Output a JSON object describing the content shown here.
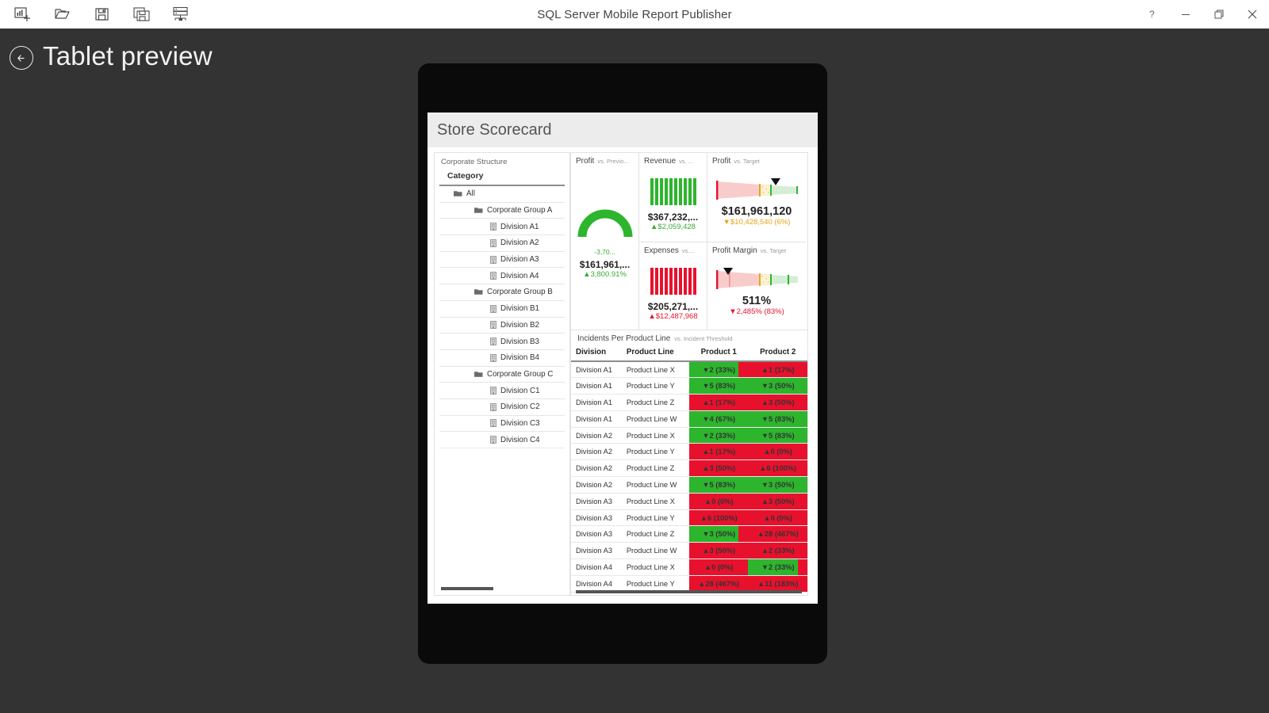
{
  "window": {
    "title": "SQL Server Mobile Report Publisher",
    "toolbar": [
      {
        "name": "new-report-icon",
        "label": "New report"
      },
      {
        "name": "open-folder-icon",
        "label": "Open"
      },
      {
        "name": "save-icon",
        "label": "Save"
      },
      {
        "name": "save-as-icon",
        "label": "Save as"
      },
      {
        "name": "save-to-server-icon",
        "label": "Save to server"
      }
    ],
    "controls": [
      {
        "name": "help-button",
        "glyph": "?"
      },
      {
        "name": "minimize-button",
        "glyph": "—"
      },
      {
        "name": "restore-button",
        "glyph": "❐"
      },
      {
        "name": "close-button",
        "glyph": "✕"
      }
    ]
  },
  "preview": {
    "back_label": "Back",
    "title": "Tablet preview"
  },
  "report": {
    "title": "Store Scorecard",
    "tree": {
      "panel_label": "Corporate Structure",
      "column_header": "Category",
      "rows": [
        {
          "label": "All",
          "level": 0,
          "icon": "folder-icon"
        },
        {
          "label": "Corporate Group A",
          "level": 1,
          "icon": "folder-icon"
        },
        {
          "label": "Division A1",
          "level": 2,
          "icon": "building-icon"
        },
        {
          "label": "Division A2",
          "level": 2,
          "icon": "building-icon"
        },
        {
          "label": "Division A3",
          "level": 2,
          "icon": "building-icon"
        },
        {
          "label": "Division A4",
          "level": 2,
          "icon": "building-icon"
        },
        {
          "label": "Corporate Group B",
          "level": 1,
          "icon": "folder-icon"
        },
        {
          "label": "Division B1",
          "level": 2,
          "icon": "building-icon"
        },
        {
          "label": "Division B2",
          "level": 2,
          "icon": "building-icon"
        },
        {
          "label": "Division B3",
          "level": 2,
          "icon": "building-icon"
        },
        {
          "label": "Division B4",
          "level": 2,
          "icon": "building-icon"
        },
        {
          "label": "Corporate Group C",
          "level": 1,
          "icon": "folder-icon"
        },
        {
          "label": "Division C1",
          "level": 2,
          "icon": "building-icon"
        },
        {
          "label": "Division C2",
          "level": 2,
          "icon": "building-icon"
        },
        {
          "label": "Division C3",
          "level": 2,
          "icon": "building-icon"
        },
        {
          "label": "Division C4",
          "level": 2,
          "icon": "building-icon"
        }
      ]
    },
    "kpis": {
      "profit_gauge": {
        "name": "Profit",
        "comparison": "vs. Previo...",
        "gauge_label": "-3,70...",
        "value": "$161,961,...",
        "delta": "▲3,800.91%",
        "delta_dir": "up",
        "delta_color": "#3aaa35"
      },
      "revenue": {
        "name": "Revenue",
        "comparison": "vs. ...",
        "value": "$367,232,...",
        "delta": "▲$2,059,428",
        "delta_color": "#3aaa35",
        "bar_color": "#2db52d",
        "bars": [
          34,
          34,
          34,
          34,
          34,
          34,
          34,
          34,
          34,
          34
        ]
      },
      "expenses": {
        "name": "Expenses",
        "comparison": "vs....",
        "value": "$205,271,...",
        "delta": "▲$12,487,968",
        "delta_color": "#e8112d",
        "bar_color": "#e8112d",
        "bars": [
          34,
          34,
          34,
          34,
          34,
          34,
          34,
          34,
          34,
          34
        ]
      },
      "profit_target": {
        "name": "Profit",
        "comparison": "vs. Target",
        "value": "$161,961,120",
        "delta": "▼$10,428,540 (6%)",
        "delta_color": "#e8a317",
        "marker_pct": 72
      },
      "profit_margin": {
        "name": "Profit Margin",
        "comparison": "vs. Target",
        "value": "511%",
        "delta": "▼2,485% (83%)",
        "delta_color": "#e8112d",
        "marker_pct": 25
      }
    },
    "table": {
      "name": "Incidents Per Product Line",
      "comparison": "vs. Incident Threshold",
      "columns": [
        "Division",
        "Product Line",
        "Product 1",
        "Product 2"
      ],
      "rows": [
        {
          "division": "Division A1",
          "line": "Product Line X",
          "p1": "▼2 (33%)",
          "p1s": "g",
          "p1w": 84,
          "p2": "▲1 (17%)",
          "p2s": "r",
          "p2w": 100
        },
        {
          "division": "Division A1",
          "line": "Product Line Y",
          "p1": "▼5 (83%)",
          "p1s": "g",
          "p1w": 100,
          "p2": "▼3 (50%)",
          "p2s": "g",
          "p2w": 100
        },
        {
          "division": "Division A1",
          "line": "Product Line Z",
          "p1": "▲1 (17%)",
          "p1s": "r",
          "p1w": 100,
          "p2": "▲3 (50%)",
          "p2s": "r",
          "p2w": 100
        },
        {
          "division": "Division A1",
          "line": "Product Line W",
          "p1": "▼4 (67%)",
          "p1s": "g",
          "p1w": 100,
          "p2": "▼5 (83%)",
          "p2s": "g",
          "p2w": 100
        },
        {
          "division": "Division A2",
          "line": "Product Line X",
          "p1": "▼2 (33%)",
          "p1s": "g",
          "p1w": 100,
          "p2": "▼5 (83%)",
          "p2s": "g",
          "p2w": 100
        },
        {
          "division": "Division A2",
          "line": "Product Line Y",
          "p1": "▲1 (17%)",
          "p1s": "r",
          "p1w": 100,
          "p2": "▲0 (0%)",
          "p2s": "r",
          "p2w": 100
        },
        {
          "division": "Division A2",
          "line": "Product Line Z",
          "p1": "▲3 (50%)",
          "p1s": "r",
          "p1w": 100,
          "p2": "▲6 (100%)",
          "p2s": "r",
          "p2w": 100
        },
        {
          "division": "Division A2",
          "line": "Product Line W",
          "p1": "▼5 (83%)",
          "p1s": "g",
          "p1w": 100,
          "p2": "▼3 (50%)",
          "p2s": "g",
          "p2w": 100
        },
        {
          "division": "Division A3",
          "line": "Product Line X",
          "p1": "▲0 (0%)",
          "p1s": "r",
          "p1w": 100,
          "p2": "▲3 (50%)",
          "p2s": "r",
          "p2w": 100
        },
        {
          "division": "Division A3",
          "line": "Product Line Y",
          "p1": "▲6 (100%)",
          "p1s": "r",
          "p1w": 100,
          "p2": "▲0 (0%)",
          "p2s": "r",
          "p2w": 100
        },
        {
          "division": "Division A3",
          "line": "Product Line Z",
          "p1": "▼3 (50%)",
          "p1s": "g",
          "p1w": 84,
          "p2": "▲28 (467%)",
          "p2s": "r",
          "p2w": 100
        },
        {
          "division": "Division A3",
          "line": "Product Line W",
          "p1": "▲3 (50%)",
          "p1s": "r",
          "p1w": 100,
          "p2": "▲2 (33%)",
          "p2s": "r",
          "p2w": 100
        },
        {
          "division": "Division A4",
          "line": "Product Line X",
          "p1": "▲0 (0%)",
          "p1s": "r",
          "p1w": 100,
          "p2": "▼2 (33%)",
          "p2s": "g",
          "p2w": 84
        },
        {
          "division": "Division A4",
          "line": "Product Line Y",
          "p1": "▲28 (467%)",
          "p1s": "r",
          "p1w": 100,
          "p2": "▲11 (183%)",
          "p2s": "r",
          "p2w": 100
        }
      ]
    }
  },
  "colors": {
    "green": "#2db52d",
    "red": "#e8112d",
    "amber": "#e8a317",
    "chrome": "#333333",
    "tablet": "#0a0a0a"
  },
  "chart_data": {
    "type": "table",
    "title": "Incidents Per Product Line",
    "subtitle": "vs. Incident Threshold",
    "columns": [
      "Division",
      "Product Line",
      "Product 1",
      "Product 2"
    ],
    "rows": [
      [
        "Division A1",
        "Product Line X",
        "2 (33%)",
        "1 (17%)"
      ],
      [
        "Division A1",
        "Product Line Y",
        "5 (83%)",
        "3 (50%)"
      ],
      [
        "Division A1",
        "Product Line Z",
        "1 (17%)",
        "3 (50%)"
      ],
      [
        "Division A1",
        "Product Line W",
        "4 (67%)",
        "5 (83%)"
      ],
      [
        "Division A2",
        "Product Line X",
        "2 (33%)",
        "5 (83%)"
      ],
      [
        "Division A2",
        "Product Line Y",
        "1 (17%)",
        "0 (0%)"
      ],
      [
        "Division A2",
        "Product Line Z",
        "3 (50%)",
        "6 (100%)"
      ],
      [
        "Division A2",
        "Product Line W",
        "5 (83%)",
        "3 (50%)"
      ],
      [
        "Division A3",
        "Product Line X",
        "0 (0%)",
        "3 (50%)"
      ],
      [
        "Division A3",
        "Product Line Y",
        "6 (100%)",
        "0 (0%)"
      ],
      [
        "Division A3",
        "Product Line Z",
        "3 (50%)",
        "28 (467%)"
      ],
      [
        "Division A3",
        "Product Line W",
        "3 (50%)",
        "2 (33%)"
      ],
      [
        "Division A4",
        "Product Line X",
        "0 (0%)",
        "2 (33%)"
      ],
      [
        "Division A4",
        "Product Line Y",
        "28 (467%)",
        "11 (183%)"
      ]
    ],
    "kpi_summary": [
      {
        "name": "Profit",
        "comparison": "vs. Previous",
        "value": "$161,961,...",
        "delta": "3,800.91%",
        "direction": "up"
      },
      {
        "name": "Revenue",
        "comparison": "vs.",
        "value": "$367,232,...",
        "delta": "$2,059,428",
        "direction": "up"
      },
      {
        "name": "Expenses",
        "comparison": "vs.",
        "value": "$205,271,...",
        "delta": "$12,487,968",
        "direction": "up"
      },
      {
        "name": "Profit",
        "comparison": "vs. Target",
        "value": "$161,961,120",
        "delta": "$10,428,540 (6%)",
        "direction": "down"
      },
      {
        "name": "Profit Margin",
        "comparison": "vs. Target",
        "value": "511%",
        "delta": "2,485% (83%)",
        "direction": "down"
      }
    ]
  }
}
